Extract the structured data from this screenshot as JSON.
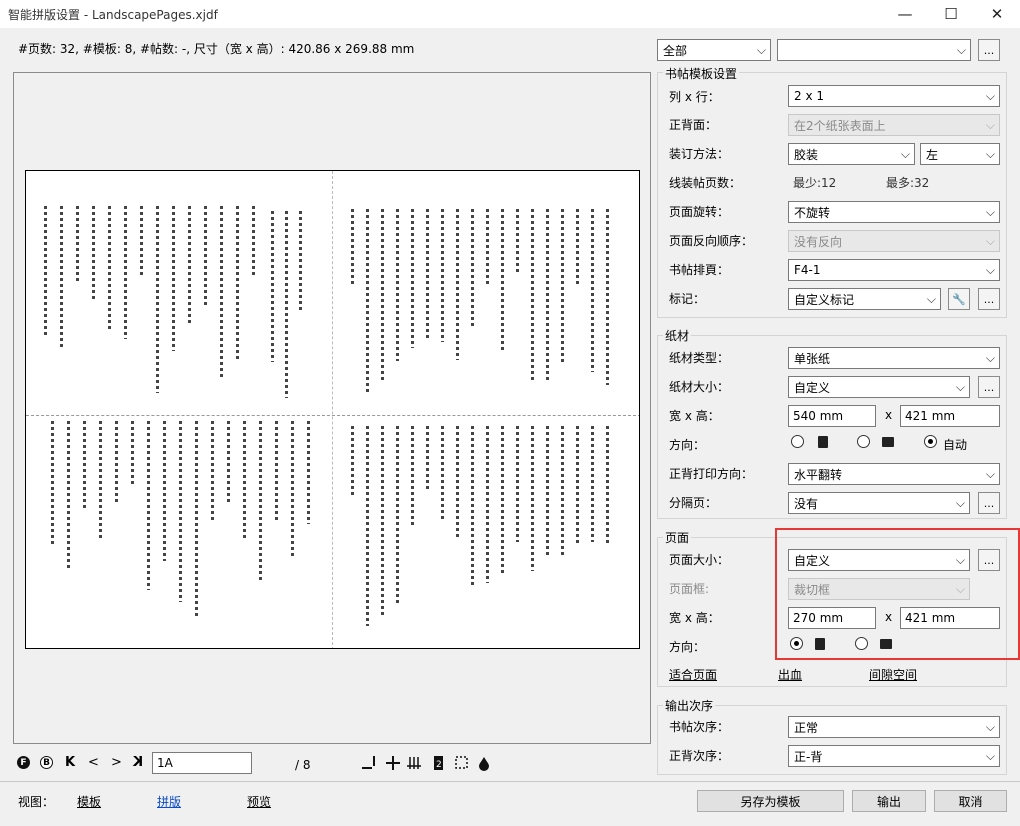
{
  "window": {
    "title": "智能拼版设置 - LandscapePages.xjdf",
    "minimize": "—",
    "maximize": "☐",
    "close": "✕"
  },
  "info": "#页数: 32, #模板: 8, #帖数: -, 尺寸（宽 x 高）: 420.86 x 269.88 mm",
  "top_filter": {
    "value": "全部",
    "value2": "",
    "more": "..."
  },
  "signature_group": {
    "title": "书帖模板设置",
    "rows": {
      "cols_rows": {
        "label": "列 x 行：",
        "value": "2 x 1"
      },
      "sides": {
        "label": "正背面：",
        "value": "在2个纸张表面上"
      },
      "binding": {
        "label": "装订方法：",
        "value": "胶装",
        "value2": "左"
      },
      "sewn": {
        "label": "线装帖页数：",
        "min": "最少:12",
        "max": "最多:32"
      },
      "rotation": {
        "label": "页面旋转：",
        "value": "不旋转"
      },
      "reverse": {
        "label": "页面反向顺序：",
        "value": "没有反向"
      },
      "fold": {
        "label": "书帖排頁：",
        "value": "F4-1"
      },
      "marks": {
        "label": "标记：",
        "value": "自定义标记",
        "wrench": "🔧",
        "more": "..."
      }
    }
  },
  "paper_group": {
    "title": "纸材",
    "rows": {
      "type": {
        "label": "纸材类型：",
        "value": "单张纸"
      },
      "size": {
        "label": "纸材大小：",
        "value": "自定义",
        "more": "..."
      },
      "wh": {
        "label": "宽 x 高：",
        "width": "540 mm",
        "x": "x",
        "height": "421 mm"
      },
      "orientation": {
        "label": "方向：",
        "auto": "自动"
      },
      "duplex": {
        "label": "正背打印方向：",
        "value": "水平翻转"
      },
      "separator": {
        "label": "分隔页：",
        "value": "没有",
        "more": "..."
      }
    }
  },
  "page_group": {
    "title": "页面",
    "rows": {
      "size": {
        "label": "页面大小：",
        "value": "自定义",
        "more": "..."
      },
      "box": {
        "label": "页面框:",
        "value": "裁切框"
      },
      "wh": {
        "label": "宽 x 高：",
        "width": "270 mm",
        "x": "x",
        "height": "421 mm"
      },
      "orientation": {
        "label": "方向："
      }
    },
    "links": {
      "fit": "适合页面",
      "bleed": "出血",
      "gap": "间隙空间"
    }
  },
  "output_group": {
    "title": "输出次序",
    "rows": {
      "sig_order": {
        "label": "书帖次序：",
        "value": "正常"
      },
      "side_order": {
        "label": "正背次序：",
        "value": "正-背"
      }
    }
  },
  "nav": {
    "page_input": "1A",
    "page_total": "/ 8",
    "front": "F",
    "back": "B",
    "first": "K",
    "prev": "<",
    "next": ">",
    "last": "K"
  },
  "footer": {
    "view_label": "视图：",
    "tab_template": "模板",
    "tab_imposition": "拼版",
    "tab_preview": "预览",
    "save_as_template": "另存为模板",
    "output": "输出",
    "cancel": "取消"
  }
}
